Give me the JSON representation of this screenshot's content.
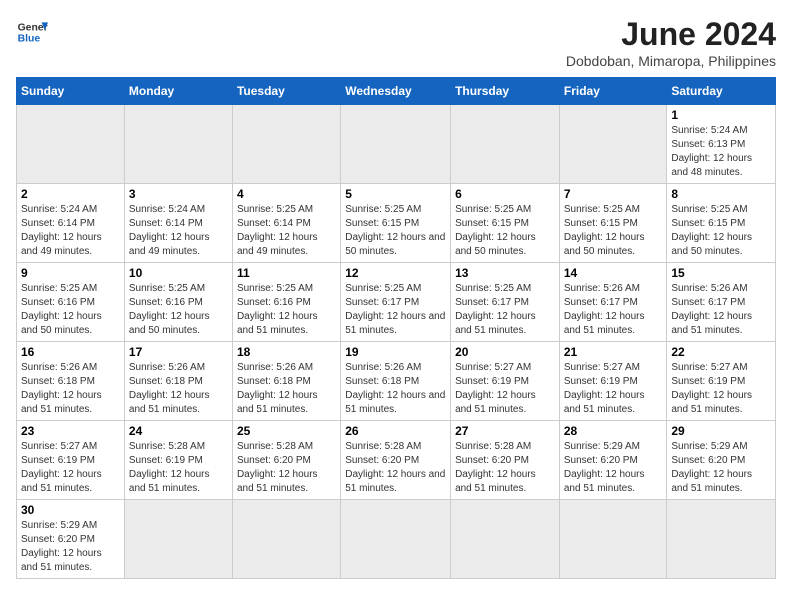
{
  "logo": {
    "line1": "General",
    "line2": "Blue"
  },
  "title": "June 2024",
  "subtitle": "Dobdoban, Mimaropa, Philippines",
  "days_of_week": [
    "Sunday",
    "Monday",
    "Tuesday",
    "Wednesday",
    "Thursday",
    "Friday",
    "Saturday"
  ],
  "weeks": [
    [
      {
        "day": "",
        "empty": true
      },
      {
        "day": "",
        "empty": true
      },
      {
        "day": "",
        "empty": true
      },
      {
        "day": "",
        "empty": true
      },
      {
        "day": "",
        "empty": true
      },
      {
        "day": "",
        "empty": true
      },
      {
        "day": "1",
        "info": "Sunrise: 5:24 AM\nSunset: 6:13 PM\nDaylight: 12 hours and 48 minutes."
      }
    ],
    [
      {
        "day": "2",
        "info": "Sunrise: 5:24 AM\nSunset: 6:14 PM\nDaylight: 12 hours and 49 minutes."
      },
      {
        "day": "3",
        "info": "Sunrise: 5:24 AM\nSunset: 6:14 PM\nDaylight: 12 hours and 49 minutes."
      },
      {
        "day": "4",
        "info": "Sunrise: 5:25 AM\nSunset: 6:14 PM\nDaylight: 12 hours and 49 minutes."
      },
      {
        "day": "5",
        "info": "Sunrise: 5:25 AM\nSunset: 6:15 PM\nDaylight: 12 hours and 50 minutes."
      },
      {
        "day": "6",
        "info": "Sunrise: 5:25 AM\nSunset: 6:15 PM\nDaylight: 12 hours and 50 minutes."
      },
      {
        "day": "7",
        "info": "Sunrise: 5:25 AM\nSunset: 6:15 PM\nDaylight: 12 hours and 50 minutes."
      },
      {
        "day": "8",
        "info": "Sunrise: 5:25 AM\nSunset: 6:15 PM\nDaylight: 12 hours and 50 minutes."
      }
    ],
    [
      {
        "day": "9",
        "info": "Sunrise: 5:25 AM\nSunset: 6:16 PM\nDaylight: 12 hours and 50 minutes."
      },
      {
        "day": "10",
        "info": "Sunrise: 5:25 AM\nSunset: 6:16 PM\nDaylight: 12 hours and 50 minutes."
      },
      {
        "day": "11",
        "info": "Sunrise: 5:25 AM\nSunset: 6:16 PM\nDaylight: 12 hours and 51 minutes."
      },
      {
        "day": "12",
        "info": "Sunrise: 5:25 AM\nSunset: 6:17 PM\nDaylight: 12 hours and 51 minutes."
      },
      {
        "day": "13",
        "info": "Sunrise: 5:25 AM\nSunset: 6:17 PM\nDaylight: 12 hours and 51 minutes."
      },
      {
        "day": "14",
        "info": "Sunrise: 5:26 AM\nSunset: 6:17 PM\nDaylight: 12 hours and 51 minutes."
      },
      {
        "day": "15",
        "info": "Sunrise: 5:26 AM\nSunset: 6:17 PM\nDaylight: 12 hours and 51 minutes."
      }
    ],
    [
      {
        "day": "16",
        "info": "Sunrise: 5:26 AM\nSunset: 6:18 PM\nDaylight: 12 hours and 51 minutes."
      },
      {
        "day": "17",
        "info": "Sunrise: 5:26 AM\nSunset: 6:18 PM\nDaylight: 12 hours and 51 minutes."
      },
      {
        "day": "18",
        "info": "Sunrise: 5:26 AM\nSunset: 6:18 PM\nDaylight: 12 hours and 51 minutes."
      },
      {
        "day": "19",
        "info": "Sunrise: 5:26 AM\nSunset: 6:18 PM\nDaylight: 12 hours and 51 minutes."
      },
      {
        "day": "20",
        "info": "Sunrise: 5:27 AM\nSunset: 6:19 PM\nDaylight: 12 hours and 51 minutes."
      },
      {
        "day": "21",
        "info": "Sunrise: 5:27 AM\nSunset: 6:19 PM\nDaylight: 12 hours and 51 minutes."
      },
      {
        "day": "22",
        "info": "Sunrise: 5:27 AM\nSunset: 6:19 PM\nDaylight: 12 hours and 51 minutes."
      }
    ],
    [
      {
        "day": "23",
        "info": "Sunrise: 5:27 AM\nSunset: 6:19 PM\nDaylight: 12 hours and 51 minutes."
      },
      {
        "day": "24",
        "info": "Sunrise: 5:28 AM\nSunset: 6:19 PM\nDaylight: 12 hours and 51 minutes."
      },
      {
        "day": "25",
        "info": "Sunrise: 5:28 AM\nSunset: 6:20 PM\nDaylight: 12 hours and 51 minutes."
      },
      {
        "day": "26",
        "info": "Sunrise: 5:28 AM\nSunset: 6:20 PM\nDaylight: 12 hours and 51 minutes."
      },
      {
        "day": "27",
        "info": "Sunrise: 5:28 AM\nSunset: 6:20 PM\nDaylight: 12 hours and 51 minutes."
      },
      {
        "day": "28",
        "info": "Sunrise: 5:29 AM\nSunset: 6:20 PM\nDaylight: 12 hours and 51 minutes."
      },
      {
        "day": "29",
        "info": "Sunrise: 5:29 AM\nSunset: 6:20 PM\nDaylight: 12 hours and 51 minutes."
      }
    ],
    [
      {
        "day": "30",
        "info": "Sunrise: 5:29 AM\nSunset: 6:20 PM\nDaylight: 12 hours and 51 minutes."
      },
      {
        "day": "",
        "empty": true
      },
      {
        "day": "",
        "empty": true
      },
      {
        "day": "",
        "empty": true
      },
      {
        "day": "",
        "empty": true
      },
      {
        "day": "",
        "empty": true
      },
      {
        "day": "",
        "empty": true
      }
    ]
  ]
}
